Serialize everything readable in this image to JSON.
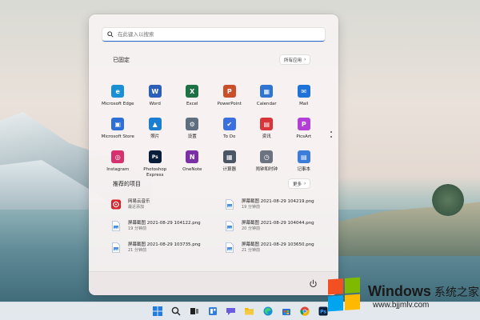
{
  "search": {
    "placeholder": "在此键入以搜索"
  },
  "pinned": {
    "title": "已固定",
    "all_apps_label": "所有应用",
    "apps": [
      {
        "label": "Microsoft Edge",
        "icon": "edge-icon",
        "color": "#1b8fd6",
        "glyph": "e"
      },
      {
        "label": "Word",
        "icon": "word-icon",
        "color": "#2b5fb8",
        "glyph": "W"
      },
      {
        "label": "Excel",
        "icon": "excel-icon",
        "color": "#1e7145",
        "glyph": "X"
      },
      {
        "label": "PowerPoint",
        "icon": "powerpoint-icon",
        "color": "#c94f2a",
        "glyph": "P"
      },
      {
        "label": "Calendar",
        "icon": "calendar-icon",
        "color": "#2f74d0",
        "glyph": "▦"
      },
      {
        "label": "Mail",
        "icon": "mail-icon",
        "color": "#1f72d8",
        "glyph": "✉"
      },
      {
        "label": "Microsoft Store",
        "icon": "store-icon",
        "color": "#2d6fd6",
        "glyph": "▣"
      },
      {
        "label": "照片",
        "icon": "photos-icon",
        "color": "#1a7fd0",
        "glyph": "▲"
      },
      {
        "label": "设置",
        "icon": "settings-icon",
        "color": "#5f6f80",
        "glyph": "⚙"
      },
      {
        "label": "To Do",
        "icon": "todo-icon",
        "color": "#3b6fe0",
        "glyph": "✔"
      },
      {
        "label": "资讯",
        "icon": "news-icon",
        "color": "#d8343a",
        "glyph": "▤"
      },
      {
        "label": "PicsArt",
        "icon": "picsart-icon",
        "color": "#b33fd6",
        "glyph": "P"
      },
      {
        "label": "Instagram",
        "icon": "instagram-icon",
        "color": "#d6306f",
        "glyph": "◎"
      },
      {
        "label": "Photoshop\nExpress",
        "icon": "photoshop-icon",
        "color": "#0a1d3a",
        "glyph": "Ps"
      },
      {
        "label": "OneNote",
        "icon": "onenote-icon",
        "color": "#7b2fa8",
        "glyph": "N"
      },
      {
        "label": "计算器",
        "icon": "calculator-icon",
        "color": "#4b5563",
        "glyph": "▦"
      },
      {
        "label": "闹钟和时钟",
        "icon": "clock-icon",
        "color": "#6b7280",
        "glyph": "◷"
      },
      {
        "label": "记事本",
        "icon": "notepad-icon",
        "color": "#3b7dd8",
        "glyph": "▤"
      }
    ]
  },
  "recommended": {
    "title": "推荐的项目",
    "more_label": "更多",
    "items": [
      {
        "name": "网易云音乐",
        "time": "最近添加",
        "icon": "netease-music-icon"
      },
      {
        "name": "屏幕截图 2021-08-29 104219.png",
        "time": "19 分钟前",
        "icon": "png-file-icon"
      },
      {
        "name": "屏幕截图 2021-08-29 104122.png",
        "time": "19 分钟前",
        "icon": "png-file-icon"
      },
      {
        "name": "屏幕截图 2021-08-29 104044.png",
        "time": "20 分钟前",
        "icon": "png-file-icon"
      },
      {
        "name": "屏幕截图 2021-08-29 103735.png",
        "time": "21 分钟前",
        "icon": "png-file-icon"
      },
      {
        "name": "屏幕截图 2021-08-29 103650.png",
        "time": "21 分钟前",
        "icon": "png-file-icon"
      }
    ]
  },
  "footer": {
    "power_icon": "power-icon"
  },
  "taskbar": {
    "icons": [
      "start-icon",
      "search-icon",
      "task-view-icon",
      "widgets-icon",
      "chat-icon",
      "file-explorer-icon",
      "edge-icon",
      "store-icon",
      "chrome-icon",
      "photoshop-icon"
    ]
  },
  "watermark": {
    "title": "Windows",
    "title_cn": "系统之家",
    "url": "www.bjjmlv.com"
  },
  "colors": {
    "accent": "#2a6ad1",
    "menu_bg": "#f7f2f2",
    "taskbar_bg": "#e8ecf0"
  }
}
